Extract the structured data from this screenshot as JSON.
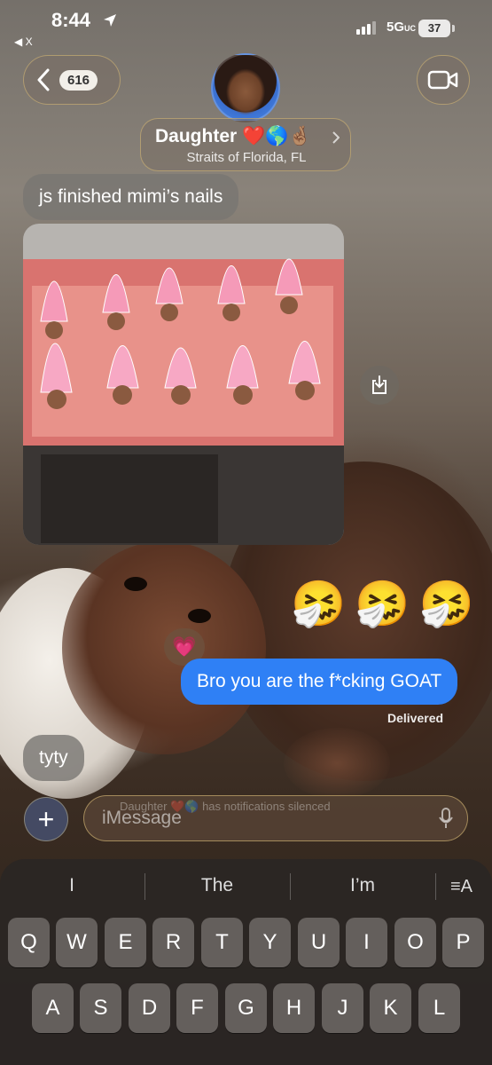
{
  "status_bar": {
    "time": "8:44",
    "back_app": "◀ X",
    "network": "5G",
    "network_suffix": "UC",
    "battery": "37"
  },
  "header": {
    "back_count": "616",
    "contact_name": "Daughter ❤️🌎🤞🏽",
    "contact_subtitle": "Straits of Florida, FL"
  },
  "messages": {
    "incoming_1": "js finished mimi’s nails",
    "emojis": [
      "🤧",
      "🤧",
      "🤧"
    ],
    "tapback": "💗",
    "outgoing_1": "Bro you are the f*cking GOAT",
    "delivered": "Delivered",
    "incoming_2": "tyty"
  },
  "composer": {
    "placeholder": "iMessage",
    "notice": "Daughter ❤️🌎 has notifications silenced"
  },
  "keyboard": {
    "suggestions": [
      "I",
      "The",
      "I’m"
    ],
    "row1": [
      "Q",
      "W",
      "E",
      "R",
      "T",
      "Y",
      "U",
      "I",
      "O",
      "P"
    ],
    "row2": [
      "A",
      "S",
      "D",
      "F",
      "G",
      "H",
      "J",
      "K",
      "L"
    ]
  },
  "colors": {
    "outgoing_bubble": "#2f80f5",
    "incoming_bubble": "#78766f",
    "glass_border": "#dcbe78"
  }
}
